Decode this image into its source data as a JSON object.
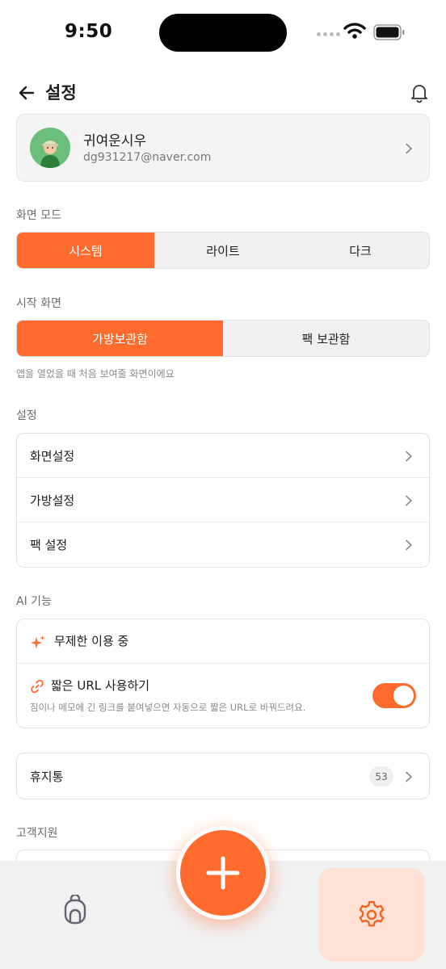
{
  "status_bar": {
    "time": "9:50"
  },
  "header": {
    "title": "설정"
  },
  "profile": {
    "name": "귀여운시우",
    "email": "dg931217@naver.com"
  },
  "screen_mode": {
    "label": "화면 모드",
    "options": [
      "시스템",
      "라이트",
      "다크"
    ],
    "selected": "시스템"
  },
  "start_screen": {
    "label": "시작 화면",
    "options": [
      "가방보관함",
      "팩 보관함"
    ],
    "selected": "가방보관함",
    "hint": "앱을 열었을 때 처음 보여줄 화면이에요"
  },
  "settings": {
    "label": "설정",
    "items": [
      "화면설정",
      "가방설정",
      "팩 설정"
    ]
  },
  "ai": {
    "label": "AI 기능",
    "unlimited": "무제한 이용 중",
    "short_url_title": "짧은 URL 사용하기",
    "short_url_desc": "짐이나 메모에 긴 링크를 붙여넣으면 자동으로 짧은 URL로 바꿔드려요.",
    "short_url_enabled": true
  },
  "trash": {
    "label": "휴지통",
    "count": "53"
  },
  "support": {
    "label": "고객지원"
  },
  "colors": {
    "accent": "#ff6b2c",
    "accent_soft": "#ffe2d5",
    "tab_bar": "#f1f1f2"
  },
  "icons": {
    "back": "arrow-left-icon",
    "bell": "bell-icon",
    "sparkle": "sparkle-icon",
    "link": "link-icon",
    "bag": "backpack-icon",
    "settings": "gear-icon",
    "add": "plus-icon"
  }
}
